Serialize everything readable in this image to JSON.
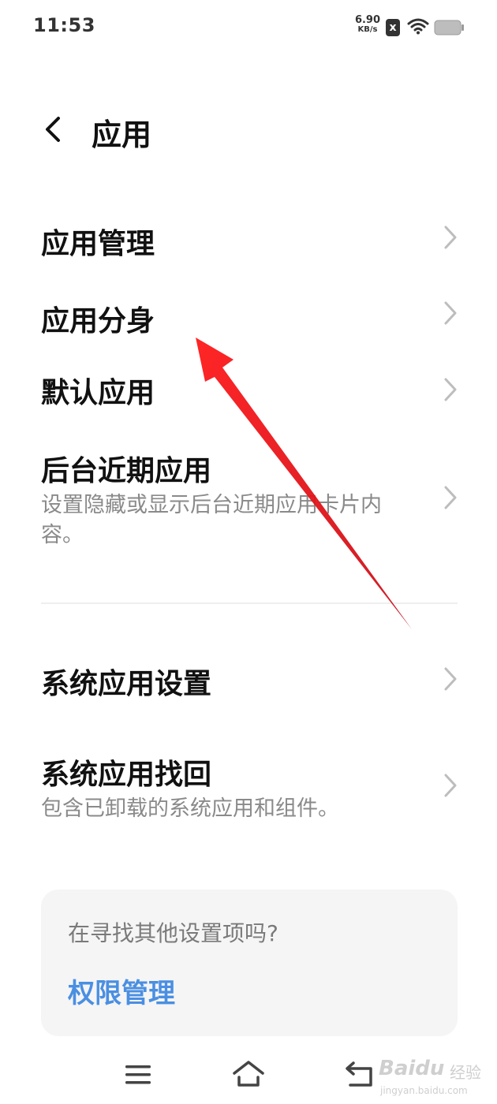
{
  "status_bar": {
    "time": "11:53",
    "net_speed_value": "6.90",
    "net_speed_unit": "KB/s",
    "sim_badge": "x",
    "icons": [
      "sim-off-icon",
      "wifi-icon",
      "battery-icon"
    ]
  },
  "app_bar": {
    "back_icon": "chevron-left-icon",
    "title": "应用"
  },
  "menu": {
    "items": [
      {
        "title": "应用管理",
        "subtitle": ""
      },
      {
        "title": "应用分身",
        "subtitle": ""
      },
      {
        "title": "默认应用",
        "subtitle": ""
      },
      {
        "title": "后台近期应用",
        "subtitle": "设置隐藏或显示后台近期应用卡片内容。"
      },
      {
        "title": "系统应用设置",
        "subtitle": ""
      },
      {
        "title": "系统应用找回",
        "subtitle": "包含已卸载的系统应用和组件。"
      }
    ]
  },
  "suggestion_card": {
    "question": "在寻找其他设置项吗?",
    "link": "权限管理"
  },
  "nav_bar": {
    "icons": [
      "menu-icon",
      "home-icon",
      "back-icon"
    ]
  },
  "annotation": {
    "arrow_color": "#e8141c"
  },
  "watermark": {
    "brand": "Baidu",
    "cn": "经验",
    "url": "jingyan.baidu.com"
  },
  "colors": {
    "link_blue": "#4a8fe2",
    "subtitle_gray": "#8a8a8a",
    "card_bg": "#f5f5f5"
  }
}
